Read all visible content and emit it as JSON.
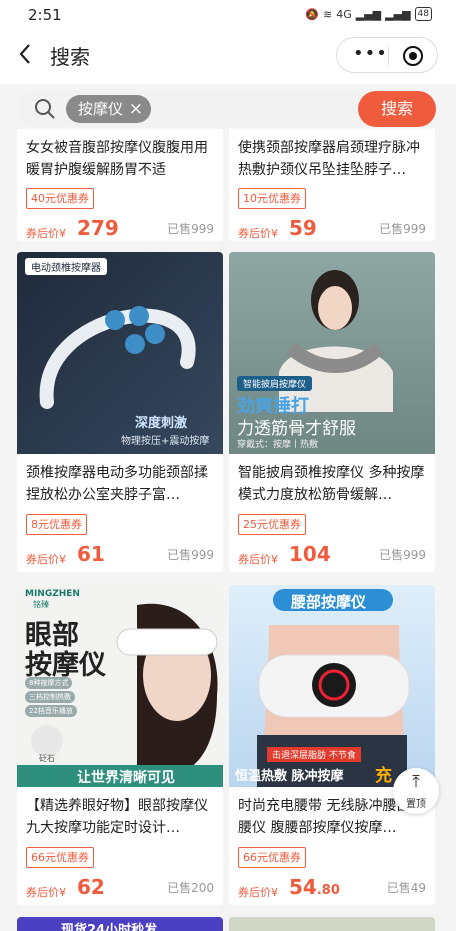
{
  "status_bar": {
    "time": "2:51",
    "battery": "48",
    "network": "4G"
  },
  "nav": {
    "title": "搜索"
  },
  "search": {
    "tag": "按摩仪",
    "button_label": "搜索"
  },
  "to_top": {
    "label": "置顶"
  },
  "products": [
    {
      "name": "女女被音腹部按摩仪腹腹用用 暖胃护腹缓解肠胃不适",
      "coupon": "40元优惠券",
      "price_label": "券后价¥",
      "price_int": "279",
      "price_dec": "",
      "sold": "已售999"
    },
    {
      "name": "使携颈部按摩器肩颈理疗脉冲热敷护颈仪吊坠挂坠脖子…",
      "coupon": "10元优惠券",
      "price_label": "券后价¥",
      "price_int": "59",
      "price_dec": "",
      "sold": "已售999"
    },
    {
      "name": "颈椎按摩器电动多功能颈部揉捏放松办公室夹脖子富…",
      "coupon": "8元优惠券",
      "price_label": "券后价¥",
      "price_int": "61",
      "price_dec": "",
      "sold": "已售999",
      "image_text": {
        "badge": "电动颈椎按摩器",
        "line1": "深度刺激",
        "line2": "物理按压+震动按摩"
      }
    },
    {
      "name": "智能披肩颈椎按摩仪 多种按摩模式力度放松筋骨缓解…",
      "coupon": "25元优惠券",
      "price_label": "券后价¥",
      "price_int": "104",
      "price_dec": "",
      "sold": "已售999",
      "image_text": {
        "badge": "智能披肩按摩仪",
        "line1": "劲爽捶打",
        "line2": "力透筋骨才舒服",
        "line3": "穿戴式：按摩丨热敷"
      }
    },
    {
      "name": "【精选养眼好物】眼部按摩仪九大按摩功能定时设计…",
      "coupon": "66元优惠券",
      "price_label": "券后价¥",
      "price_int": "62",
      "price_dec": "",
      "sold": "已售200",
      "image_text": {
        "brand": "MINGZHEN",
        "brand_cn": "铭臻",
        "line1": "眼部",
        "line2": "按摩仪",
        "feat1": "8种按摩方式",
        "feat2": "三档控制热敷",
        "feat3": "22档音乐播放",
        "stone": "砭石",
        "slogan": "让世界清晰可见"
      }
    },
    {
      "name": "时尚充电腰带 无线脉冲腰部护腰仪 腹腰部按摩仪按摩…",
      "coupon": "66元优惠券",
      "price_label": "券后价¥",
      "price_int": "54",
      "price_dec": ".80",
      "sold": "已售49",
      "image_text": {
        "title": "腰部按摩仪",
        "sub": "击退深层脂肪 不节食",
        "line1": "恒温热敷 脉冲按摩",
        "corner": "充"
      }
    }
  ],
  "banner_next": {
    "text": "现货24小时秒发"
  },
  "colors": {
    "accent": "#ef5b3d",
    "tag_bg": "#8a8a8a",
    "page_bg": "#f4f4f4"
  }
}
